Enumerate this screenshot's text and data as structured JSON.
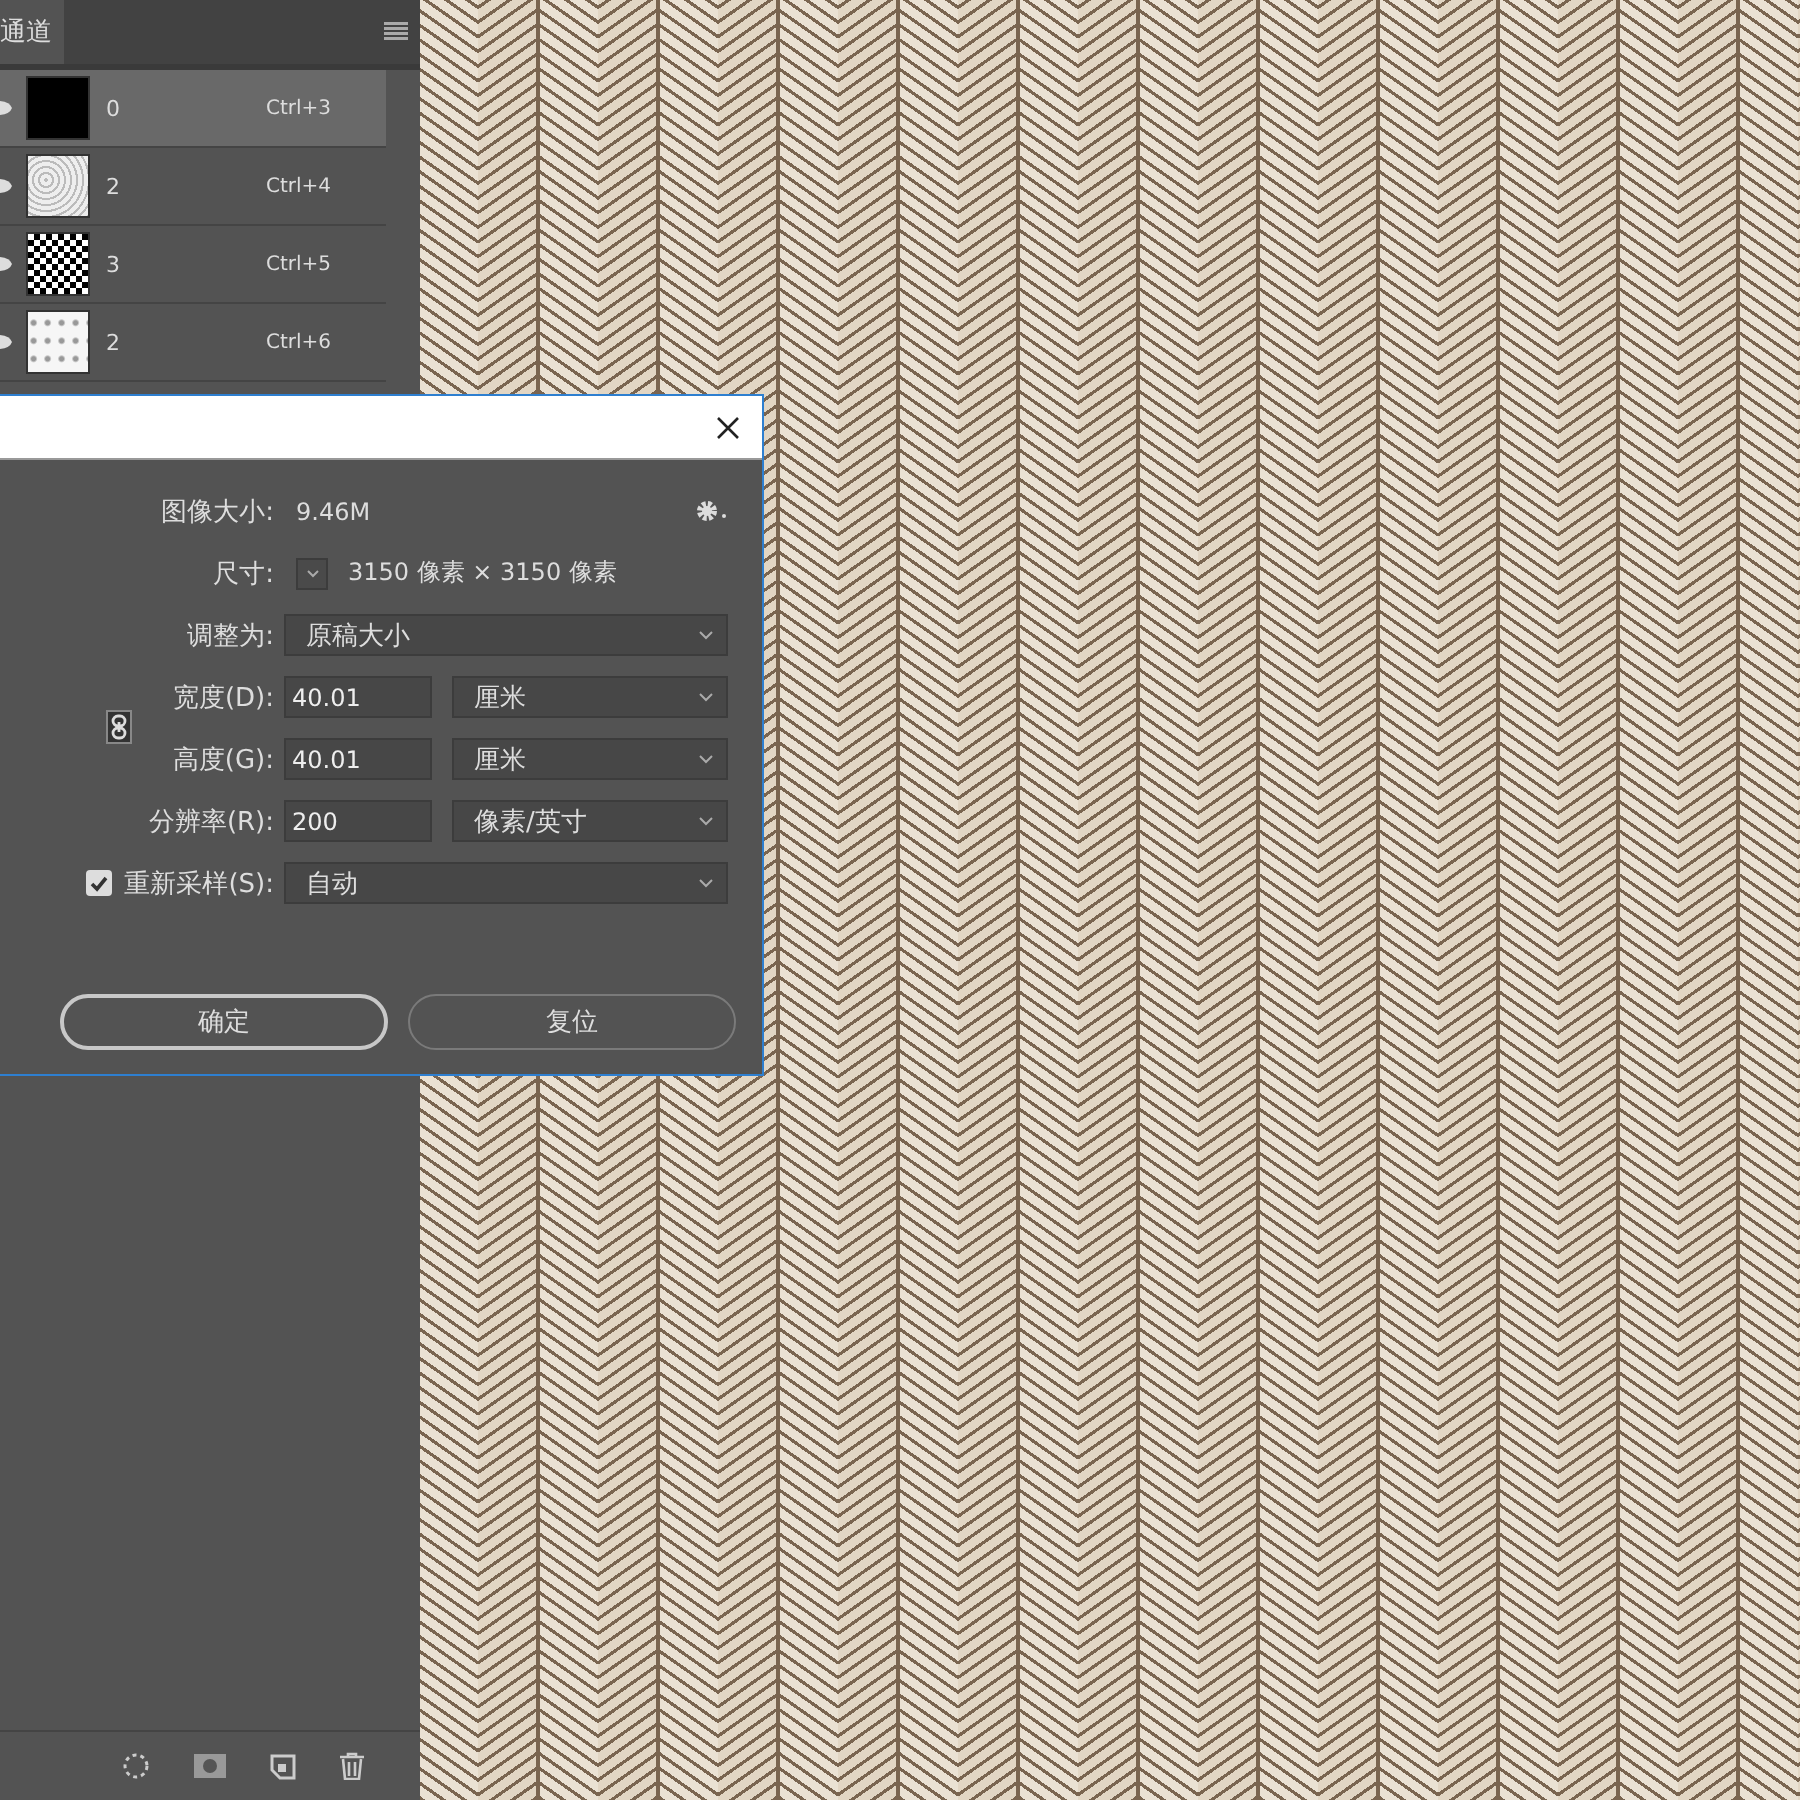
{
  "channels_panel": {
    "tab": "通道",
    "channels": [
      {
        "name": "0",
        "shortcut": "Ctrl+3",
        "selected": true,
        "visible": true,
        "kind": "black"
      },
      {
        "name": "2",
        "shortcut": "Ctrl+4",
        "selected": false,
        "visible": true,
        "kind": "speckle"
      },
      {
        "name": "3",
        "shortcut": "Ctrl+5",
        "selected": false,
        "visible": true,
        "kind": "noise"
      },
      {
        "name": "2",
        "shortcut": "Ctrl+6",
        "selected": false,
        "visible": true,
        "kind": "sparse"
      }
    ]
  },
  "dialog": {
    "image_size": {
      "label": "图像大小:",
      "value": "9.46M"
    },
    "dimensions": {
      "label": "尺寸:",
      "value": "3150 像素 × 3150 像素"
    },
    "fit_to": {
      "label": "调整为:",
      "value": "原稿大小"
    },
    "width": {
      "label": "宽度(D):",
      "value": "40.01",
      "unit": "厘米"
    },
    "height": {
      "label": "高度(G):",
      "value": "40.01",
      "unit": "厘米"
    },
    "resolution": {
      "label": "分辨率(R):",
      "value": "200",
      "unit": "像素/英寸"
    },
    "resample": {
      "label": "重新采样(S):",
      "checked": true,
      "value": "自动"
    },
    "buttons": [
      "确定",
      "复位"
    ]
  }
}
